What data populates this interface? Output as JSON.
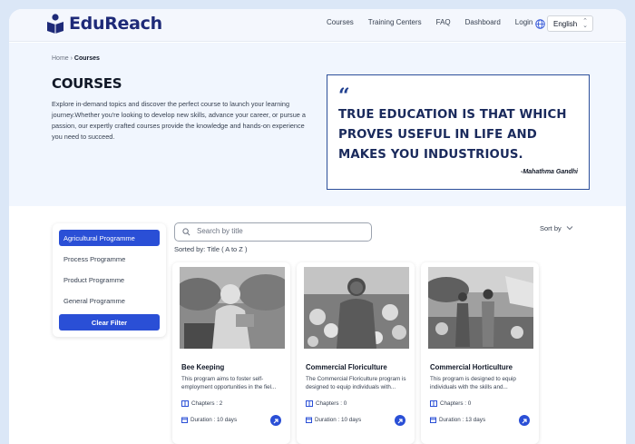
{
  "brand": {
    "name": "EduReach"
  },
  "nav": {
    "items": [
      "Courses",
      "Training Centers",
      "FAQ",
      "Dashboard",
      "Login"
    ]
  },
  "language": {
    "selected": "English"
  },
  "breadcrumb": {
    "home": "Home",
    "current": "Courses"
  },
  "hero": {
    "title": "COURSES",
    "description": "Explore in-demand topics and discover the perfect course to launch your learning journey.Whether you're looking to develop new skills, advance your career, or pursue a passion, our expertly crafted courses provide the knowledge and hands-on experience you need to succeed.",
    "quote_mark": "“",
    "quote": "True education is that which proves useful in life and makes you industrious.",
    "quote_author": "-Mahathma Gandhi"
  },
  "filters": {
    "items": [
      "Agricultural Programme",
      "Process Programme",
      "Product Programme",
      "General Programme"
    ],
    "active_index": 0,
    "clear_label": "Clear Filter"
  },
  "search": {
    "placeholder": "Search by title",
    "value": ""
  },
  "sort": {
    "sorted_by": "Sorted by: Title ( A to Z )",
    "sort_label": "Sort by"
  },
  "cards": [
    {
      "title": "Bee Keeping",
      "description": "This program aims to foster self-employment opportunities in the fiel...",
      "chapters": "Chapters : 2",
      "duration": "Duration : 10 days"
    },
    {
      "title": "Commercial Floriculture",
      "description": "The Commercial Floriculture program is designed to equip individuals with...",
      "chapters": "Chapters : 0",
      "duration": "Duration : 10 days"
    },
    {
      "title": "Commercial Horticulture",
      "description": "This program is designed to equip individuals with the skills and...",
      "chapters": "Chapters : 0",
      "duration": "Duration : 13 days"
    }
  ],
  "colors": {
    "brand": "#1e2a78",
    "accent": "#2a4fd6",
    "quote_border": "#2d4f9a"
  }
}
